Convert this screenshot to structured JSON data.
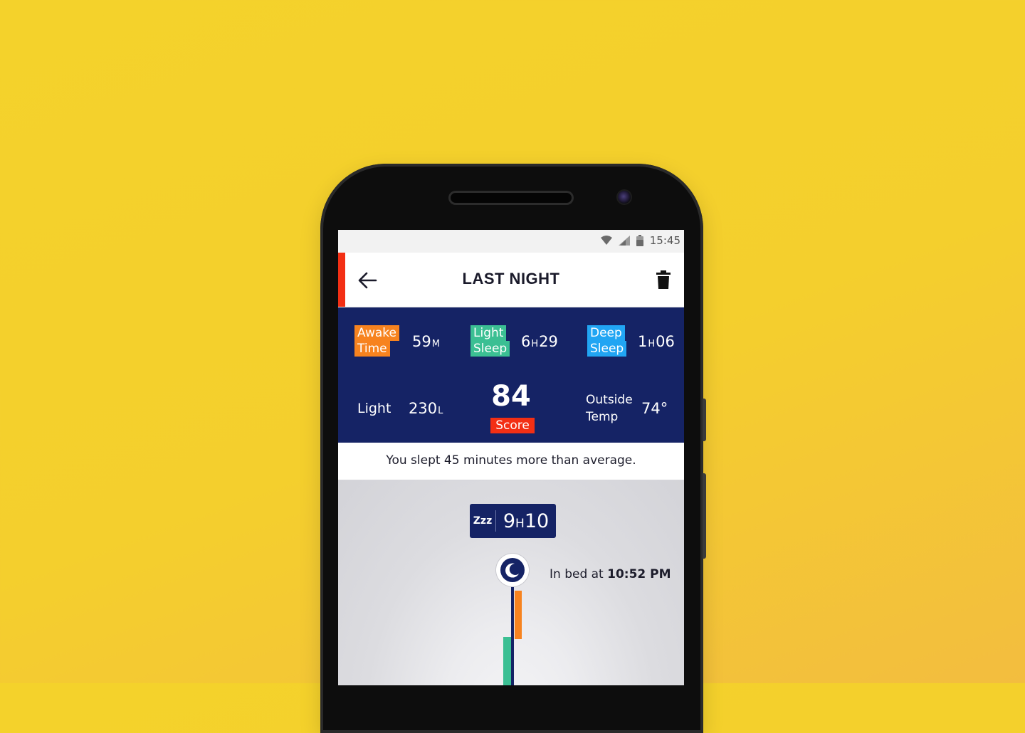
{
  "status_bar": {
    "time": "15:45"
  },
  "app_bar": {
    "title": "LAST NIGHT"
  },
  "stats": {
    "awake": {
      "label_line1": "Awake",
      "label_line2": "Time",
      "value_num": "59",
      "value_unit": "M"
    },
    "light_sleep": {
      "label_line1": "Light",
      "label_line2": "Sleep",
      "value_h": "6",
      "value_unit": "H",
      "value_m": "29"
    },
    "deep_sleep": {
      "label_line1": "Deep",
      "label_line2": "Sleep",
      "value_h": "1",
      "value_unit": "H",
      "value_m": "06"
    },
    "light": {
      "label": "Light",
      "value_num": "230",
      "value_unit": "L"
    },
    "score": {
      "value": "84",
      "label": "Score"
    },
    "outside_temp": {
      "label_line1": "Outside",
      "label_line2": "Temp",
      "value": "74°"
    }
  },
  "summary": "You slept 45 minutes more than average.",
  "timeline": {
    "zz_icon": "Zzz",
    "duration_h": "9",
    "duration_unit": "H",
    "duration_m": "10",
    "in_bed_prefix": "In bed at",
    "in_bed_time": "10:52 PM"
  },
  "colors": {
    "background": "#f4d22b",
    "navy": "#152365",
    "accent_red": "#f32f14",
    "awake_orange": "#f7831f",
    "light_green": "#3bbf93",
    "deep_blue": "#21a5f3"
  }
}
